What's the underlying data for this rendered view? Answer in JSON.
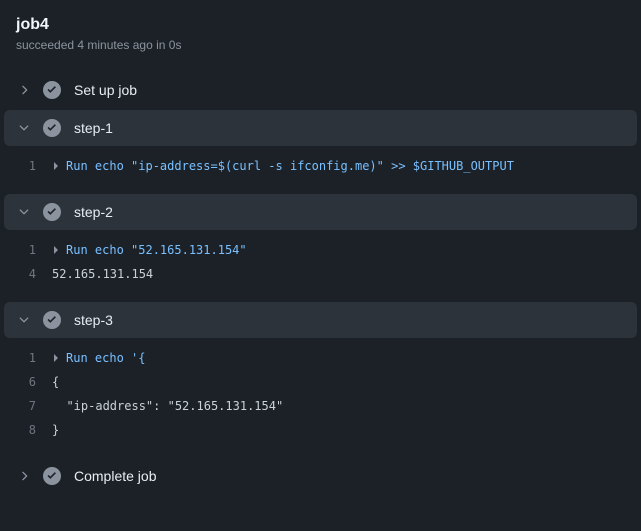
{
  "header": {
    "title": "job4",
    "status": "succeeded 4 minutes ago in 0s"
  },
  "steps": [
    {
      "expanded": false,
      "name": "Set up job",
      "logs": []
    },
    {
      "expanded": true,
      "name": "step-1",
      "logs": [
        {
          "num": "1",
          "caret": true,
          "text": "Run echo \"ip-address=$(curl -s ifconfig.me)\" >> $GITHUB_OUTPUT",
          "cmd": true
        }
      ]
    },
    {
      "expanded": true,
      "name": "step-2",
      "logs": [
        {
          "num": "1",
          "caret": true,
          "text": "Run echo \"52.165.131.154\"",
          "cmd": true
        },
        {
          "num": "4",
          "caret": false,
          "text": "52.165.131.154",
          "cmd": false
        }
      ]
    },
    {
      "expanded": true,
      "name": "step-3",
      "logs": [
        {
          "num": "1",
          "caret": true,
          "text": "Run echo '{",
          "cmd": true
        },
        {
          "num": "6",
          "caret": false,
          "text": "{",
          "cmd": false
        },
        {
          "num": "7",
          "caret": false,
          "text": "  \"ip-address\": \"52.165.131.154\"",
          "cmd": false
        },
        {
          "num": "8",
          "caret": false,
          "text": "}",
          "cmd": false
        }
      ]
    },
    {
      "expanded": false,
      "name": "Complete job",
      "logs": []
    }
  ]
}
